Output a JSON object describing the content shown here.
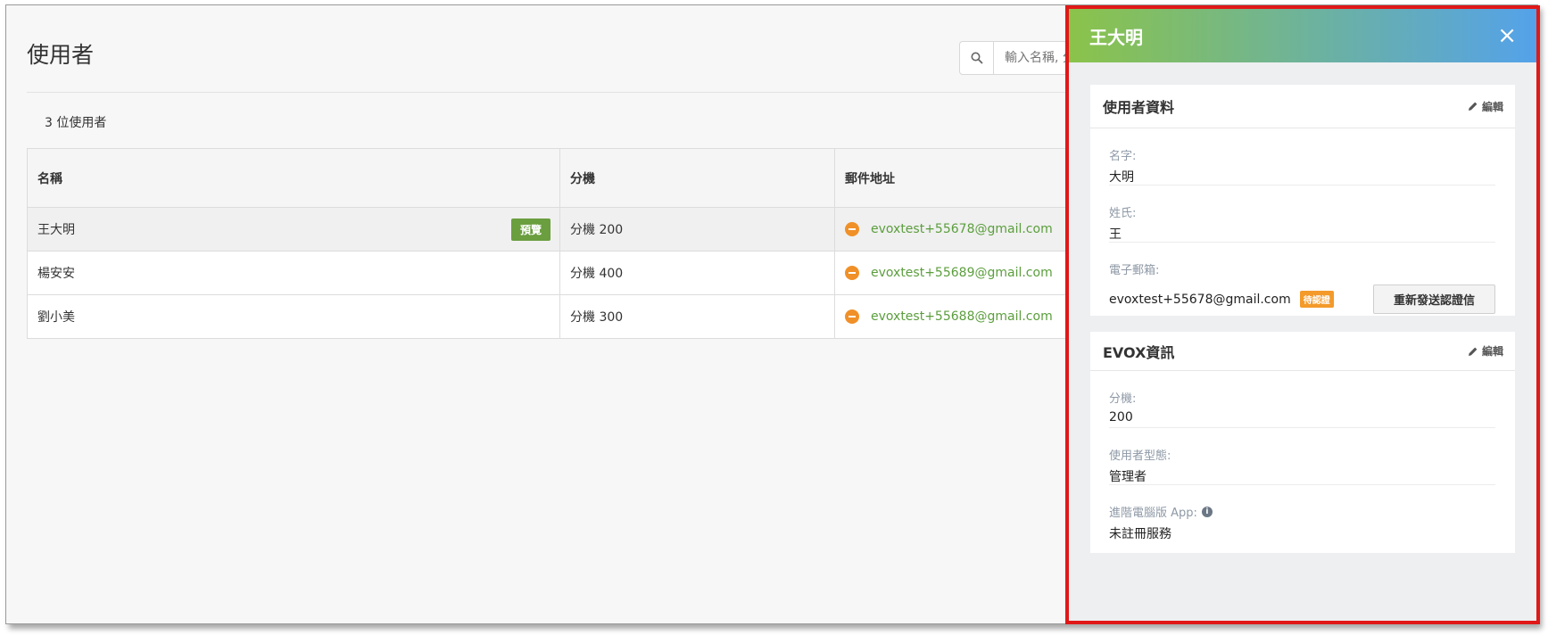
{
  "page": {
    "title": "使用者",
    "search_placeholder": "輸入名稱, 分",
    "user_count": "3 位使用者"
  },
  "table": {
    "headers": [
      "名稱",
      "分機",
      "郵件地址"
    ],
    "preview_label": "預覽",
    "rows": [
      {
        "name": "王大明",
        "ext": "分機 200",
        "email": "evoxtest+55678@gmail.com"
      },
      {
        "name": "楊安安",
        "ext": "分機 400",
        "email": "evoxtest+55689@gmail.com"
      },
      {
        "name": "劉小美",
        "ext": "分機 300",
        "email": "evoxtest+55688@gmail.com"
      }
    ]
  },
  "panel": {
    "title": "王大明",
    "close_icon": "×",
    "user_card": {
      "title": "使用者資料",
      "edit_label": "編輯",
      "first_name_label": "名字:",
      "first_name": "大明",
      "last_name_label": "姓氏:",
      "last_name": "王",
      "email_label": "電子郵箱:",
      "email": "evoxtest+55678@gmail.com",
      "pending_badge": "待認證",
      "resend_label": "重新發送認證信"
    },
    "evox_card": {
      "title": "EVOX資訊",
      "edit_label": "編輯",
      "ext_label": "分機:",
      "ext": "200",
      "role_label": "使用者型態:",
      "role": "管理者",
      "app_label": "進階電腦版 App:",
      "app_value": "未註冊服務"
    }
  },
  "colors": {
    "accent_green": "#6a9e3f",
    "link_green": "#5b9e3d",
    "status_orange": "#f09028",
    "highlight_red": "#e01818",
    "header_gradient_start": "#8bc34a",
    "header_gradient_end": "#54a2ea"
  }
}
